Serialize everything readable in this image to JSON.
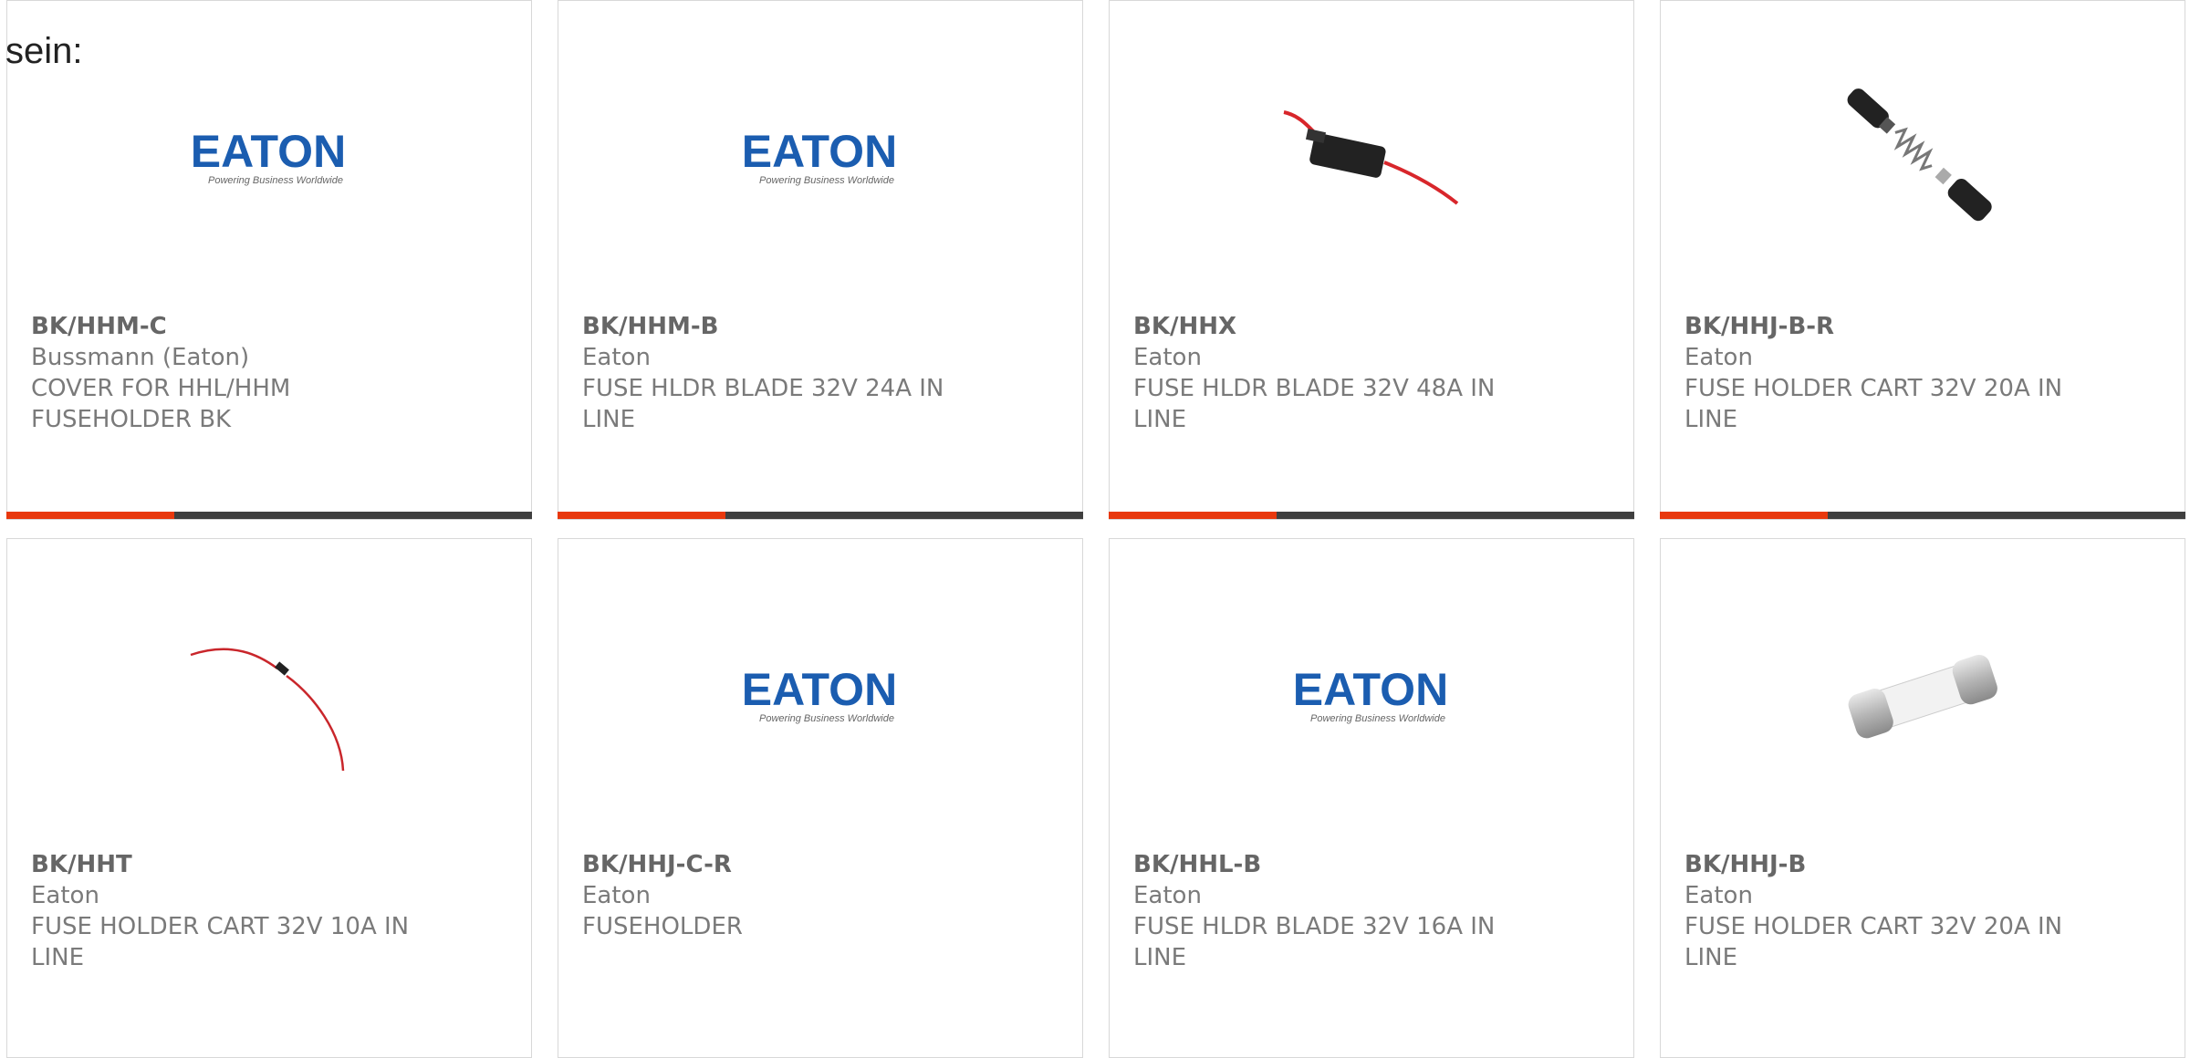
{
  "intro_text": "sein:",
  "colors": {
    "accent": "#e8380d",
    "bar": "#3f3f3f",
    "eaton_blue": "#1b5db0"
  },
  "products": [
    {
      "part": "BK/HHM-C",
      "maker": "Bussmann (Eaton)",
      "desc": "COVER FOR HHL/HHM FUSEHOLDER BK",
      "image": "eaton-logo",
      "logo_text": "EATON",
      "logo_tagline": "Powering Business Worldwide",
      "progress": 0.32
    },
    {
      "part": "BK/HHM-B",
      "maker": "Eaton",
      "desc": "FUSE HLDR BLADE 32V 24A IN LINE",
      "image": "eaton-logo",
      "logo_text": "EATON",
      "logo_tagline": "Powering Business Worldwide",
      "progress": 0.32
    },
    {
      "part": "BK/HHX",
      "maker": "Eaton",
      "desc": "FUSE HLDR BLADE 32V 48A IN LINE",
      "image": "blade-fuse-holder-photo",
      "progress": 0.32
    },
    {
      "part": "BK/HHJ-B-R",
      "maker": "Eaton",
      "desc": "FUSE HOLDER CART 32V 20A IN LINE",
      "image": "cartridge-holder-parts-photo",
      "progress": 0.32
    },
    {
      "part": "BK/HHT",
      "maker": "Eaton",
      "desc": "FUSE HOLDER CART 32V 10A IN LINE",
      "image": "inline-wire-photo"
    },
    {
      "part": "BK/HHJ-C-R",
      "maker": "Eaton",
      "desc": "FUSEHOLDER",
      "image": "eaton-logo",
      "logo_text": "EATON",
      "logo_tagline": "Powering Business Worldwide"
    },
    {
      "part": "BK/HHL-B",
      "maker": "Eaton",
      "desc": "FUSE HLDR BLADE 32V 16A IN LINE",
      "image": "eaton-logo",
      "logo_text": "EATON",
      "logo_tagline": "Powering Business Worldwide"
    },
    {
      "part": "BK/HHJ-B",
      "maker": "Eaton",
      "desc": "FUSE HOLDER CART 32V 20A IN LINE",
      "image": "glass-fuse-photo"
    }
  ]
}
